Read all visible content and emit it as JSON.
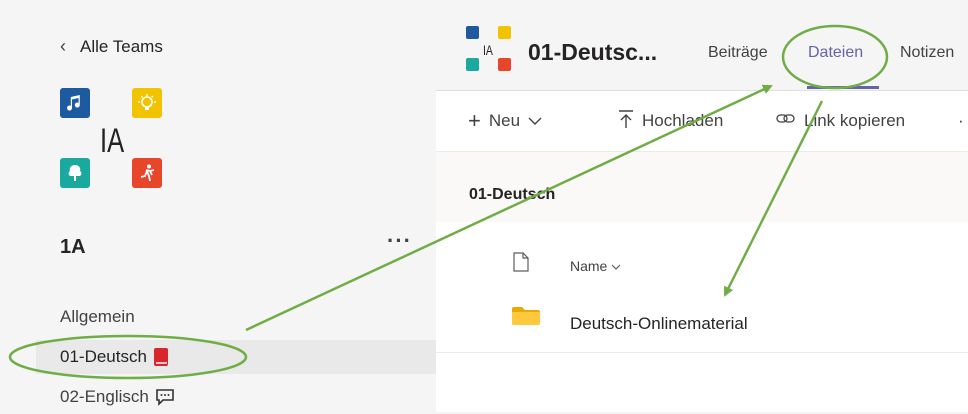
{
  "sidebar": {
    "back_label": "Alle Teams",
    "logo_text": "IA",
    "team_name": "1A",
    "more_label": "···",
    "channels": [
      {
        "label": "Allgemein"
      },
      {
        "label": "01-Deutsch"
      },
      {
        "label": "02-Englisch"
      }
    ]
  },
  "header": {
    "channel_title": "01-Deutsc...",
    "mini_logo_text": "IA",
    "tabs": [
      {
        "label": "Beiträge"
      },
      {
        "label": "Dateien"
      },
      {
        "label": "Notizen"
      }
    ]
  },
  "toolbar": {
    "new_label": "Neu",
    "upload_label": "Hochladen",
    "copy_link_label": "Link kopieren"
  },
  "files": {
    "breadcrumb": "01-Deutsch",
    "column_name": "Name",
    "items": [
      {
        "name": "Deutsch-Onlinematerial"
      }
    ]
  },
  "colors": {
    "accent": "#6264a7",
    "annotation": "#70ad47",
    "folder": "#ffc83d"
  }
}
